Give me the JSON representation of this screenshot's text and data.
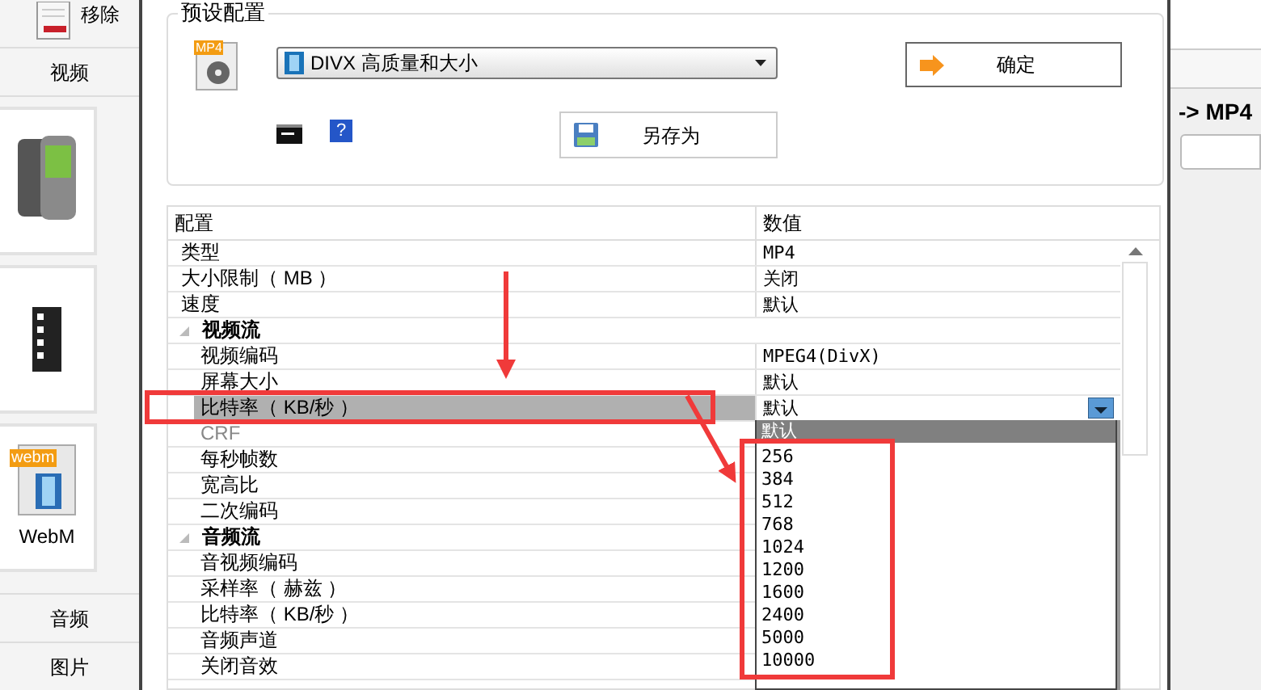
{
  "sidebar": {
    "remove_button": "移除",
    "video_tab": "视频",
    "tiles": [
      {
        "kind": "phone"
      },
      {
        "kind": "film"
      },
      {
        "kind": "webm",
        "label": "WebM",
        "badge": "webm"
      }
    ],
    "audio_tab": "音频",
    "image_tab": "图片"
  },
  "preset": {
    "group_title": "预设配置",
    "icon_badge": "MP4",
    "help_icon": "?",
    "selected_preset": "DIVX 高质量和大小",
    "ok_button": "确定",
    "save_as_button": "另存为"
  },
  "grid": {
    "columns": [
      "配置",
      "数值"
    ],
    "rows": [
      {
        "kind": "property",
        "label": "类型",
        "value": "MP4",
        "selected": false,
        "disabled": false
      },
      {
        "kind": "property",
        "label": "大小限制（ MB ）",
        "value": "关闭",
        "selected": false,
        "disabled": false
      },
      {
        "kind": "property",
        "label": "速度",
        "value": "默认",
        "selected": false,
        "disabled": false
      },
      {
        "kind": "category",
        "label": "视频流",
        "expanded": true,
        "children": [
          {
            "kind": "property",
            "label": "视频编码",
            "value": "MPEG4(DivX)",
            "selected": false,
            "disabled": false
          },
          {
            "kind": "property",
            "label": "屏幕大小",
            "value": "默认",
            "selected": false,
            "disabled": false
          },
          {
            "kind": "property",
            "label": "比特率（ KB/秒 ）",
            "value": "默认",
            "selected": true,
            "disabled": false
          },
          {
            "kind": "property",
            "label": "CRF",
            "selected": false,
            "disabled": true
          },
          {
            "kind": "property",
            "label": "每秒帧数",
            "selected": false,
            "disabled": false
          },
          {
            "kind": "property",
            "label": "宽高比",
            "selected": false,
            "disabled": false
          },
          {
            "kind": "property",
            "label": "二次编码",
            "selected": false,
            "disabled": false
          }
        ]
      },
      {
        "kind": "category",
        "label": "音频流",
        "expanded": true,
        "children": [
          {
            "kind": "property",
            "label": "音视频编码",
            "selected": false,
            "disabled": false
          },
          {
            "kind": "property",
            "label": "采样率（ 赫兹 ）",
            "selected": false,
            "disabled": false
          },
          {
            "kind": "property",
            "label": "比特率（ KB/秒 ）",
            "selected": false,
            "disabled": false
          },
          {
            "kind": "property",
            "label": "音频声道",
            "selected": false,
            "disabled": false
          },
          {
            "kind": "property",
            "label": "关闭音效",
            "selected": false,
            "disabled": false
          }
        ]
      }
    ]
  },
  "dropdown": {
    "items": [
      {
        "label": "默认",
        "selected": true
      },
      {
        "label": "256",
        "selected": false
      },
      {
        "label": "384",
        "selected": false
      },
      {
        "label": "512",
        "selected": false
      },
      {
        "label": "768",
        "selected": false
      },
      {
        "label": "1024",
        "selected": false
      },
      {
        "label": "1200",
        "selected": false
      },
      {
        "label": "1600",
        "selected": false
      },
      {
        "label": "2400",
        "selected": false
      },
      {
        "label": "5000",
        "selected": false
      },
      {
        "label": "10000",
        "selected": false
      }
    ]
  },
  "right_panel": {
    "title": "-> MP4"
  }
}
